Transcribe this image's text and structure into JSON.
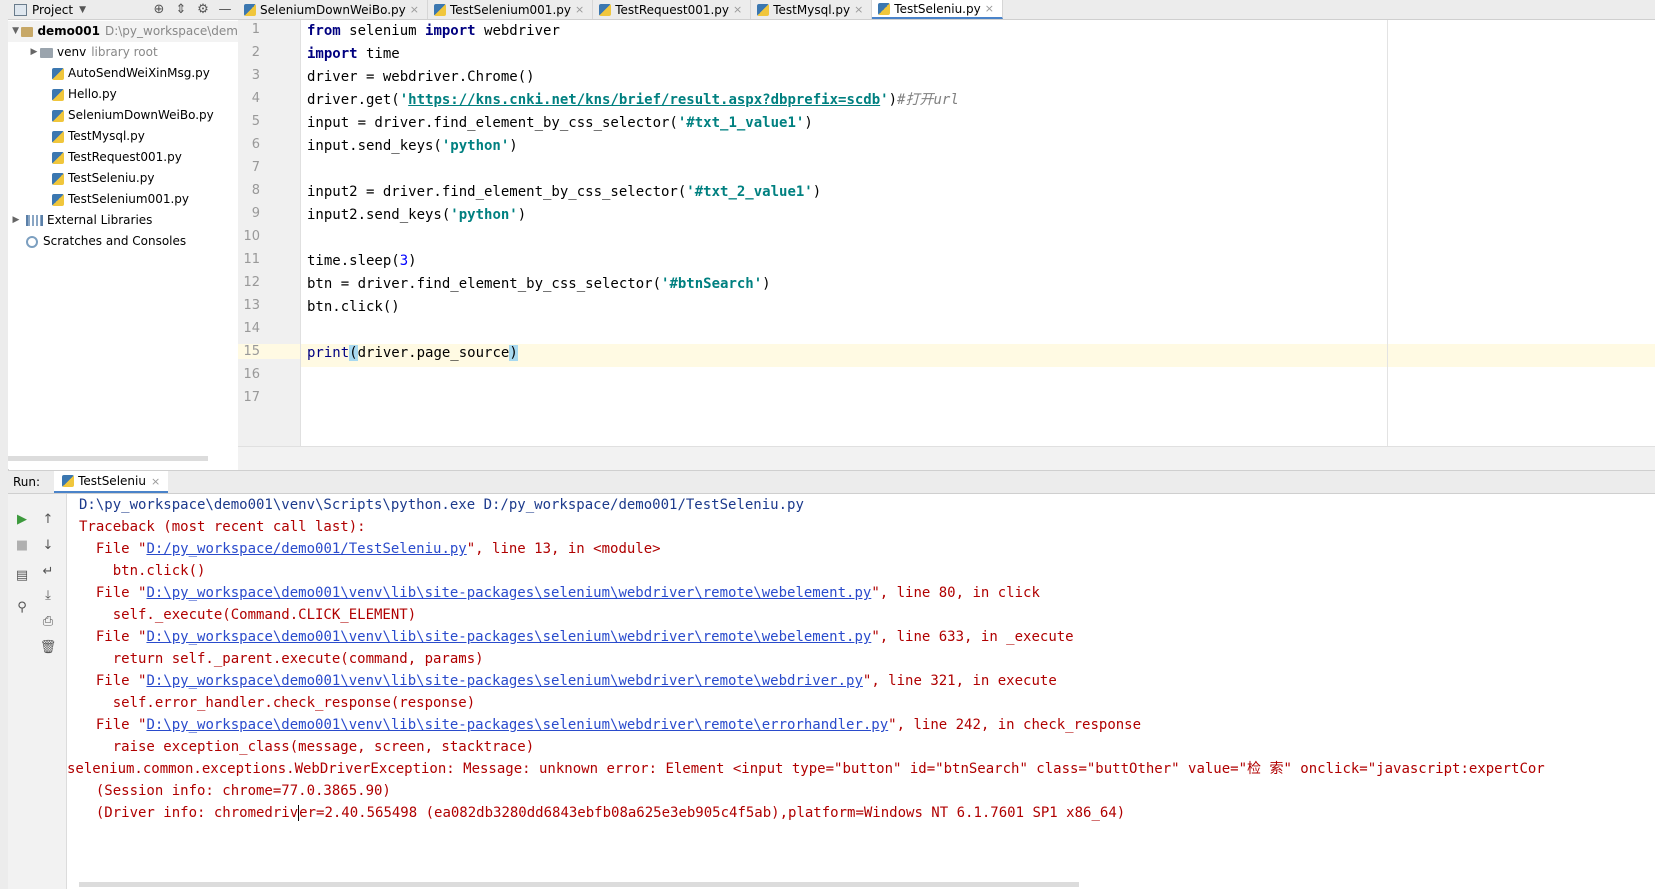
{
  "project_panel": {
    "title": "Project",
    "tree": [
      {
        "label": "demo001",
        "detail": "D:\\py_workspace\\dem",
        "kind": "root"
      },
      {
        "label": "venv",
        "detail": "library root",
        "kind": "folder"
      },
      {
        "label": "AutoSendWeiXinMsg.py",
        "kind": "file"
      },
      {
        "label": "Hello.py",
        "kind": "file"
      },
      {
        "label": "SeleniumDownWeiBo.py",
        "kind": "file"
      },
      {
        "label": "TestMysql.py",
        "kind": "file"
      },
      {
        "label": "TestRequest001.py",
        "kind": "file"
      },
      {
        "label": "TestSeleniu.py",
        "kind": "file"
      },
      {
        "label": "TestSelenium001.py",
        "kind": "file"
      },
      {
        "label": "External Libraries",
        "kind": "lib"
      },
      {
        "label": "Scratches and Consoles",
        "kind": "scratch"
      }
    ]
  },
  "tabs": [
    {
      "label": "SeleniumDownWeiBo.py",
      "active": false
    },
    {
      "label": "TestSelenium001.py",
      "active": false
    },
    {
      "label": "TestRequest001.py",
      "active": false
    },
    {
      "label": "TestMysql.py",
      "active": false
    },
    {
      "label": "TestSeleniu.py",
      "active": true
    }
  ],
  "editor": {
    "line_numbers": [
      "1",
      "2",
      "3",
      "4",
      "5",
      "6",
      "7",
      "8",
      "9",
      "10",
      "11",
      "12",
      "13",
      "14",
      "15",
      "16",
      "17"
    ],
    "current_line": 15,
    "l1": {
      "kw1": "from",
      "mod": " selenium ",
      "kw2": "import",
      "name": " webdriver"
    },
    "l2": {
      "kw": "import",
      "name": " time"
    },
    "l3": "driver = webdriver.Chrome()",
    "l4": {
      "pre": "driver.get(",
      "q1": "'",
      "url": "https://kns.cnki.net/kns/brief/result.aspx?dbprefix=scdb",
      "q2": "'",
      "post": ")",
      "comment": "#打开url"
    },
    "l5": {
      "pre": "input = driver.find_element_by_css_selector(",
      "str": "'#txt_1_value1'",
      "post": ")"
    },
    "l6": {
      "pre": "input.send_keys(",
      "str": "'python'",
      "post": ")"
    },
    "l8": {
      "pre": "input2 = driver.find_element_by_css_selector(",
      "str": "'#txt_2_value1'",
      "post": ")"
    },
    "l9": {
      "pre": "input2.send_keys(",
      "str": "'python'",
      "post": ")"
    },
    "l11": {
      "pre": "time.sleep(",
      "num": "3",
      "post": ")"
    },
    "l12": {
      "pre": "btn = driver.find_element_by_css_selector(",
      "str": "'#btnSearch'",
      "post": ")"
    },
    "l13": "btn.click()",
    "l15": {
      "fn": "print",
      "open": "(",
      "arg": "driver.page_source",
      "close": ")"
    }
  },
  "run_panel": {
    "label": "Run:",
    "tab_label": "TestSeleniu",
    "console": {
      "cmd": "D:\\py_workspace\\demo001\\venv\\Scripts\\python.exe D:/py_workspace/demo001/TestSeleniu.py",
      "traceback": "Traceback (most recent call last):",
      "frames": [
        {
          "pre": "  File \"",
          "link": "D:/py_workspace/demo001/TestSeleniu.py",
          "post": "\", line 13, in <module>",
          "code": "    btn.click()"
        },
        {
          "pre": "  File \"",
          "link": "D:\\py_workspace\\demo001\\venv\\lib\\site-packages\\selenium\\webdriver\\remote\\webelement.py",
          "post": "\", line 80, in click",
          "code": "    self._execute(Command.CLICK_ELEMENT)"
        },
        {
          "pre": "  File \"",
          "link": "D:\\py_workspace\\demo001\\venv\\lib\\site-packages\\selenium\\webdriver\\remote\\webelement.py",
          "post": "\", line 633, in _execute",
          "code": "    return self._parent.execute(command, params)"
        },
        {
          "pre": "  File \"",
          "link": "D:\\py_workspace\\demo001\\venv\\lib\\site-packages\\selenium\\webdriver\\remote\\webdriver.py",
          "post": "\", line 321, in execute",
          "code": "    self.error_handler.check_response(response)"
        },
        {
          "pre": "  File \"",
          "link": "D:\\py_workspace\\demo001\\venv\\lib\\site-packages\\selenium\\webdriver\\remote\\errorhandler.py",
          "post": "\", line 242, in check_response",
          "code": "    raise exception_class(message, screen, stacktrace)"
        }
      ],
      "exception": "selenium.common.exceptions.WebDriverException: Message: unknown error: Element <input type=\"button\" id=\"btnSearch\" class=\"buttOther\" value=\"检 索\" onclick=\"javascript:expertCor",
      "session": "  (Session info: chrome=77.0.3865.90)",
      "driver_a": "  (Driver info: chromedriv",
      "driver_b": "er=2.40.565498 (ea082db3280dd6843ebfb08a625e3eb905c4f5ab),platform=Windows NT 6.1.7601 SP1 x86_64)"
    }
  }
}
